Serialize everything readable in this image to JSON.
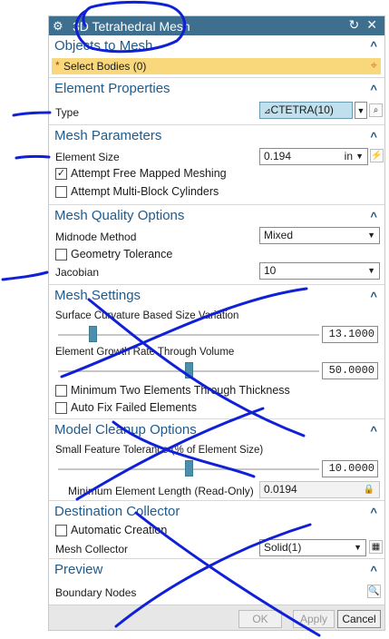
{
  "dialog": {
    "title": "3D Tetrahedral Mesh",
    "reset_icon": "↻",
    "close_icon": "✕"
  },
  "objects_to_mesh": {
    "header": "Objects to Mesh",
    "select_bodies": "Select Bodies (0)"
  },
  "element_properties": {
    "header": "Element Properties",
    "type_label": "Type",
    "type_value": "CTETRA(10)"
  },
  "mesh_parameters": {
    "header": "Mesh Parameters",
    "element_size_label": "Element Size",
    "element_size_value": "0.194",
    "element_size_unit": "in",
    "attempt_free_mapped": "Attempt Free Mapped Meshing",
    "attempt_free_mapped_checked": true,
    "attempt_multi_block": "Attempt Multi-Block Cylinders",
    "attempt_multi_block_checked": false
  },
  "mesh_quality": {
    "header": "Mesh Quality Options",
    "midnode_label": "Midnode Method",
    "midnode_value": "Mixed",
    "geometry_tolerance": "Geometry Tolerance",
    "jacobian_label": "Jacobian",
    "jacobian_value": "10"
  },
  "mesh_settings": {
    "header": "Mesh Settings",
    "surface_curvature_label": "Surface Curvature Based Size Variation",
    "surface_curvature_value": "13.1000",
    "surface_curvature_level": 0.131,
    "element_growth_label": "Element Growth Rate Through Volume",
    "element_growth_value": "50.0000",
    "element_growth_level": 0.5,
    "min_two_elements": "Minimum Two Elements Through Thickness",
    "auto_fix": "Auto Fix Failed Elements"
  },
  "model_cleanup": {
    "header": "Model Cleanup Options",
    "small_feature_label": "Small Feature Tolerance (% of Element Size)",
    "small_feature_value": "10.0000",
    "small_feature_level": 0.5,
    "min_length_label": "Minimum Element Length (Read-Only)",
    "min_length_value": "0.0194"
  },
  "destination": {
    "header": "Destination Collector",
    "automatic_creation": "Automatic Creation",
    "mesh_collector_label": "Mesh Collector",
    "mesh_collector_value": "Solid(1)"
  },
  "preview": {
    "header": "Preview",
    "boundary_nodes_label": "Boundary Nodes"
  },
  "footer": {
    "ok": "OK",
    "apply": "Apply",
    "cancel": "Cancel"
  },
  "colors": {
    "title_bar": "#3e6f8e",
    "section_header": "#1e5b8c",
    "selection_highlight": "#f9d87b",
    "slider_thumb": "#4b8fad",
    "annotation_ink": "#1020d8"
  }
}
